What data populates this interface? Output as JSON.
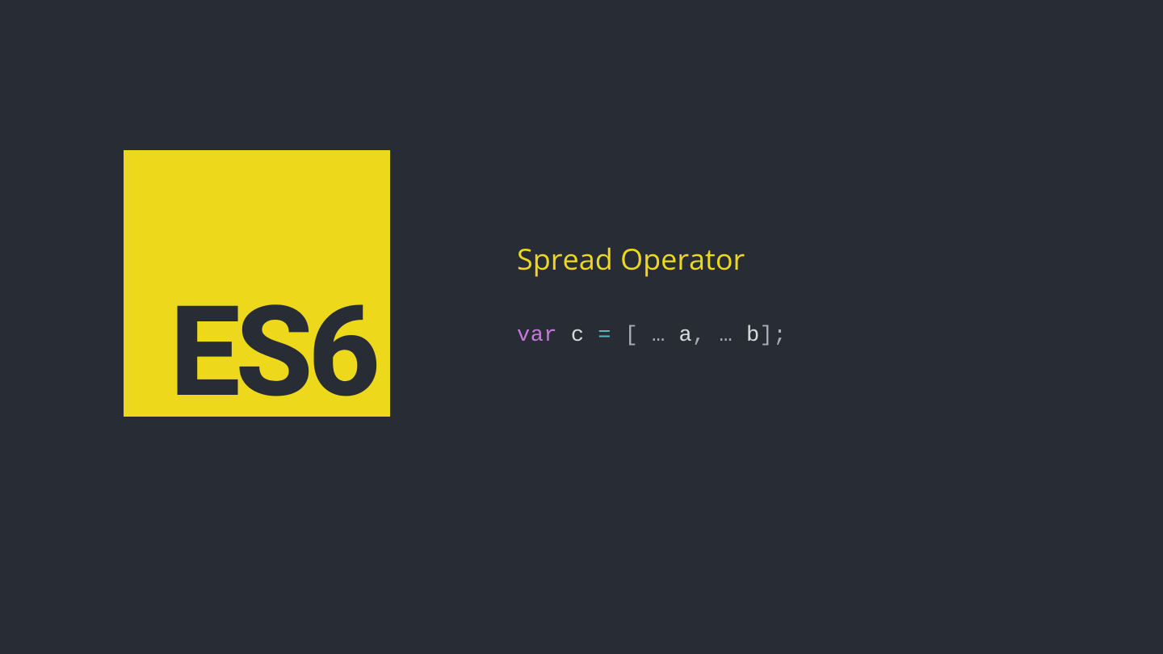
{
  "logo": {
    "text": "ES6"
  },
  "title": "Spread Operator",
  "code": {
    "keyword": "var",
    "sp1": " ",
    "name": "c",
    "sp2": " ",
    "equals": "=",
    "sp3": " ",
    "lbracket": "[",
    "sp4": " ",
    "spread1": "…",
    "sp5": " ",
    "id_a": "a",
    "comma": ",",
    "sp6": "  ",
    "spread2": "…",
    "sp7": " ",
    "id_b": "b",
    "rbracket": "]",
    "semi": ";"
  }
}
